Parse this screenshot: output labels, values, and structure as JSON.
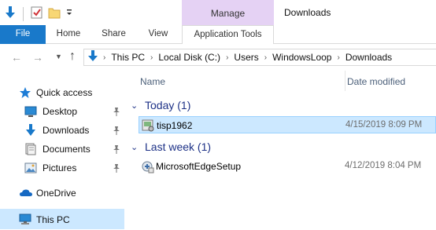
{
  "window": {
    "title": "Downloads"
  },
  "contextual_tab": {
    "group_label": "Manage",
    "tab_label": "Application Tools"
  },
  "ribbon": {
    "tabs": [
      "File",
      "Home",
      "Share",
      "View"
    ]
  },
  "address": {
    "crumbs": [
      "This PC",
      "Local Disk (C:)",
      "Users",
      "WindowsLoop",
      "Downloads"
    ]
  },
  "sidebar": {
    "quick_access": "Quick access",
    "pinned": [
      "Desktop",
      "Downloads",
      "Documents",
      "Pictures"
    ],
    "onedrive": "OneDrive",
    "this_pc": "This PC"
  },
  "columns": {
    "name": "Name",
    "date": "Date modified"
  },
  "groups": [
    {
      "label": "Today (1)",
      "files": [
        {
          "name": "tisp1962",
          "date": "4/15/2019 8:09 PM",
          "selected": true
        }
      ]
    },
    {
      "label": "Last week (1)",
      "files": [
        {
          "name": "MicrosoftEdgeSetup",
          "date": "4/12/2019 8:04 PM",
          "selected": false
        }
      ]
    }
  ],
  "colors": {
    "accent": "#1979ca",
    "manage_bg": "#e5d2f4",
    "selection": "#cce8ff",
    "group_text": "#1e3287"
  },
  "icons": [
    "down-arrow-icon",
    "properties-check-icon",
    "new-folder-icon",
    "star-icon",
    "desktop-icon",
    "download-icon",
    "documents-icon",
    "pictures-icon",
    "cloud-icon",
    "computer-icon",
    "pin-icon",
    "setup-icon"
  ]
}
